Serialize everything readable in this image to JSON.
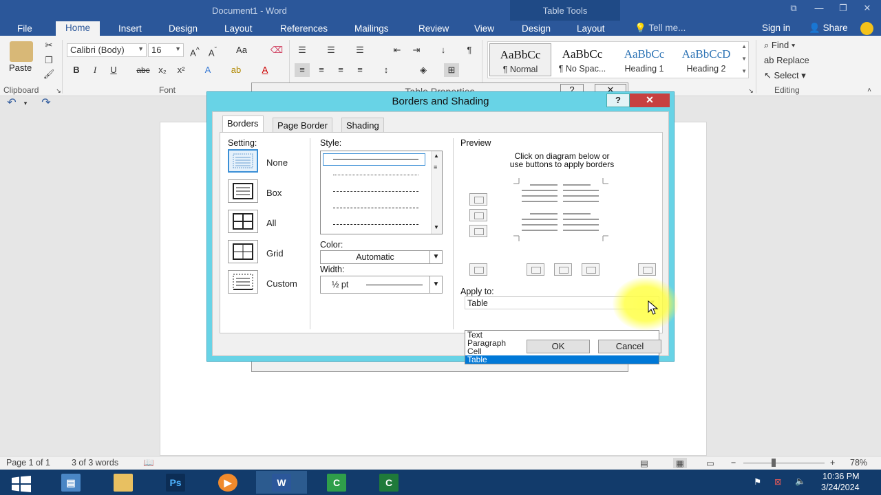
{
  "window": {
    "title": "Document1 - Word",
    "context_title": "Table Tools"
  },
  "ribbon_tabs": [
    "File",
    "Home",
    "Insert",
    "Design",
    "Layout",
    "References",
    "Mailings",
    "Review",
    "View",
    "Design",
    "Layout"
  ],
  "tell_me": "Tell me...",
  "sign_in": "Sign in",
  "share": "Share",
  "clipboard": {
    "paste": "Paste",
    "label": "Clipboard"
  },
  "font": {
    "name": "Calibri (Body)",
    "size": "16",
    "label": "Font",
    "case_btn": "Aa"
  },
  "styles": [
    {
      "sample": "AaBbCc",
      "name": "¶ Normal"
    },
    {
      "sample": "AaBbCc",
      "name": "¶ No Spac..."
    },
    {
      "sample": "AaBbCc",
      "name": "Heading 1"
    },
    {
      "sample": "AaBbCcD",
      "name": "Heading 2"
    }
  ],
  "editing": {
    "find": "Find",
    "replace": "Replace",
    "select": "Select",
    "label": "Editing"
  },
  "ghost_dialog": {
    "title": "Table Properties",
    "help": "?",
    "close": "✕"
  },
  "dialog": {
    "title": "Borders and Shading",
    "help": "?",
    "close": "✕",
    "tabs": [
      "Borders",
      "Page Border",
      "Shading"
    ],
    "setting_label": "Setting:",
    "settings": [
      "None",
      "Box",
      "All",
      "Grid",
      "Custom"
    ],
    "style_label": "Style:",
    "color_label": "Color:",
    "color_value": "Automatic",
    "width_label": "Width:",
    "width_value": "½ pt",
    "preview_label": "Preview",
    "preview_hint_1": "Click on diagram below or",
    "preview_hint_2": "use buttons to apply borders",
    "apply_label": "Apply to:",
    "apply_value": "Table",
    "apply_options": [
      "Text",
      "Paragraph",
      "Cell",
      "Table"
    ],
    "ok": "OK",
    "cancel": "Cancel"
  },
  "status": {
    "page": "Page 1 of 1",
    "words": "3 of 3 words",
    "zoom": "78%"
  },
  "taskbar": {
    "time": "10:36 PM",
    "date": "3/24/2024",
    "apps": [
      "windows-start",
      "server-manager",
      "file-explorer",
      "photoshop",
      "media-player",
      "word",
      "camtasia-recorder",
      "camtasia-studio"
    ]
  },
  "colors": {
    "word_blue": "#2b579a",
    "dialog_frame": "#68d3e6",
    "selection": "#0078d7",
    "close_red": "#c74040",
    "taskbar": "#123b6b"
  }
}
